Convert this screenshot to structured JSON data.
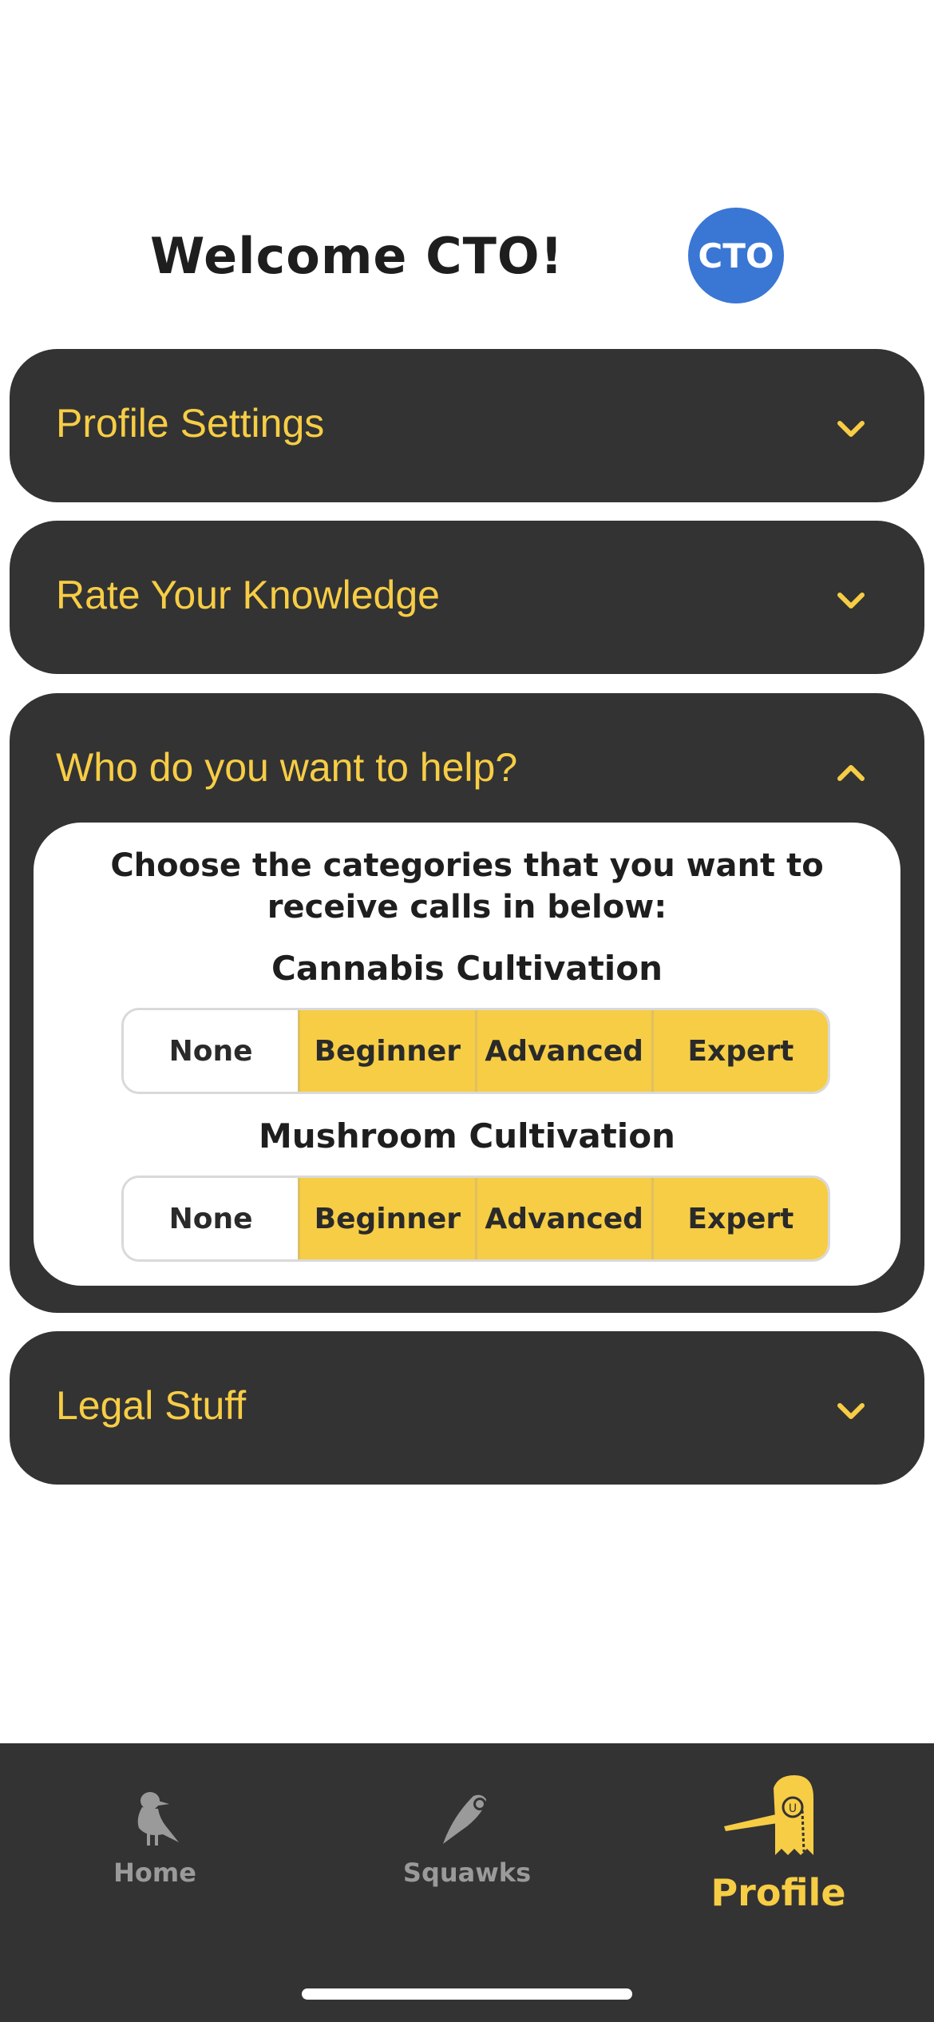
{
  "header": {
    "welcome": "Welcome CTO!",
    "avatar_initials": "CTO"
  },
  "panels": {
    "profile_settings": {
      "title": "Profile Settings",
      "expanded": false
    },
    "rate_knowledge": {
      "title": "Rate Your Knowledge",
      "expanded": false
    },
    "help": {
      "title": "Who do you want to help?",
      "expanded": true,
      "prompt_line1": "Choose the categories that you want to",
      "prompt_line2": "receive calls in below:",
      "categories": [
        {
          "name": "Cannabis Cultivation",
          "options": [
            "None",
            "Beginner",
            "Advanced",
            "Expert"
          ],
          "selected": [
            "Beginner",
            "Advanced",
            "Expert"
          ]
        },
        {
          "name": "Mushroom Cultivation",
          "options": [
            "None",
            "Beginner",
            "Advanced",
            "Expert"
          ],
          "selected": [
            "Beginner",
            "Advanced",
            "Expert"
          ]
        }
      ]
    },
    "legal": {
      "title": "Legal Stuff",
      "expanded": false
    }
  },
  "tabbar": {
    "home": {
      "label": "Home",
      "icon": "seagull-icon"
    },
    "squawks": {
      "label": "Squawks",
      "icon": "feather-bird-icon"
    },
    "profile": {
      "label": "Profile",
      "icon": "monocle-ghost-icon",
      "active": true
    }
  },
  "colors": {
    "accent": "#f7cd45",
    "panel": "#333333",
    "avatar": "#3a76d4",
    "inactive_tab": "#9a9a9a"
  }
}
